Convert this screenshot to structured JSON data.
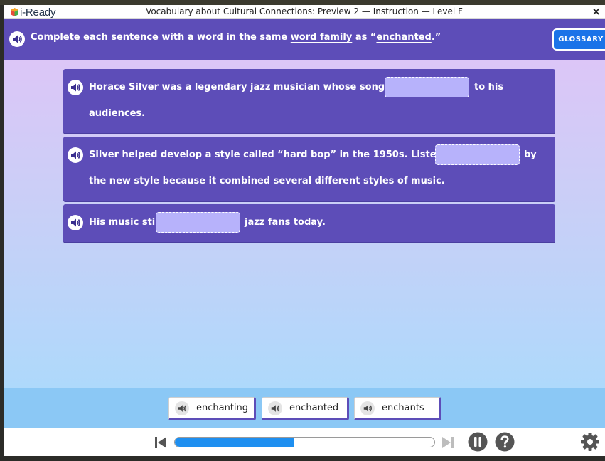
{
  "window": {
    "brand": "i-Ready",
    "title": "Vocabulary about Cultural Connections: Preview 2 — Instruction — Level F",
    "close_label": "×"
  },
  "instruction": {
    "text_before": "Complete each sentence with a word in the same ",
    "term": "word family",
    "text_mid": " as “",
    "target_word": "enchanted",
    "text_after": ".”",
    "glossary_label": "GLOSSARY"
  },
  "sentences": [
    {
      "line1_before": "Horace Silver was a legendary jazz musician whose songs were",
      "line1_after": "to his",
      "line2": "audiences.",
      "blank_value": ""
    },
    {
      "line1_before": "Silver helped develop a style called “hard bop” in the 1950s. Listeners were",
      "line1_after": "by",
      "line2": "the new style because it combined several different styles of music.",
      "blank_value": ""
    },
    {
      "line1_before": "His music still",
      "line1_after": "jazz fans today.",
      "blank_value": ""
    }
  ],
  "word_bank": [
    {
      "label": "enchanting"
    },
    {
      "label": "enchanted"
    },
    {
      "label": "enchants"
    }
  ],
  "footer": {
    "progress_fraction": 0.46
  },
  "colors": {
    "accent_purple": "#5d4db8",
    "glossary_blue": "#1b73e8",
    "progress_blue": "#1e8ff0",
    "blank_fill": "#b7b2fb"
  },
  "icons": [
    "speaker-icon",
    "skip-back-icon",
    "skip-forward-icon",
    "pause-icon",
    "help-icon",
    "gear-icon",
    "close-icon"
  ]
}
